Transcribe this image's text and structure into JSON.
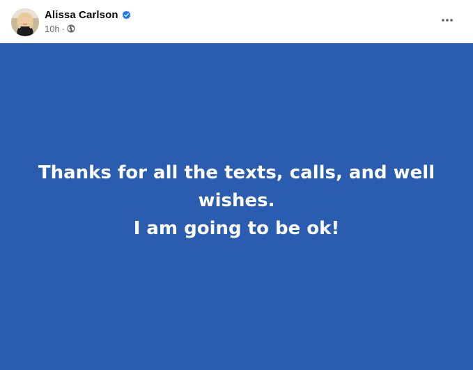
{
  "post": {
    "author": {
      "name": "Alissa Carlson",
      "verified": true,
      "avatar_icon": "profile-photo"
    },
    "meta": {
      "time": "10h",
      "separator": "·",
      "audience_icon": "globe-icon"
    },
    "menu_icon": "more-options-icon",
    "background_color": "#2a5cb0",
    "text_lines": [
      "Thanks for all the texts, calls, and well wishes.",
      "I am going to be ok!"
    ]
  },
  "colors": {
    "verified_badge": "#1877f2",
    "meta_text": "#65676b",
    "name_text": "#050505"
  }
}
